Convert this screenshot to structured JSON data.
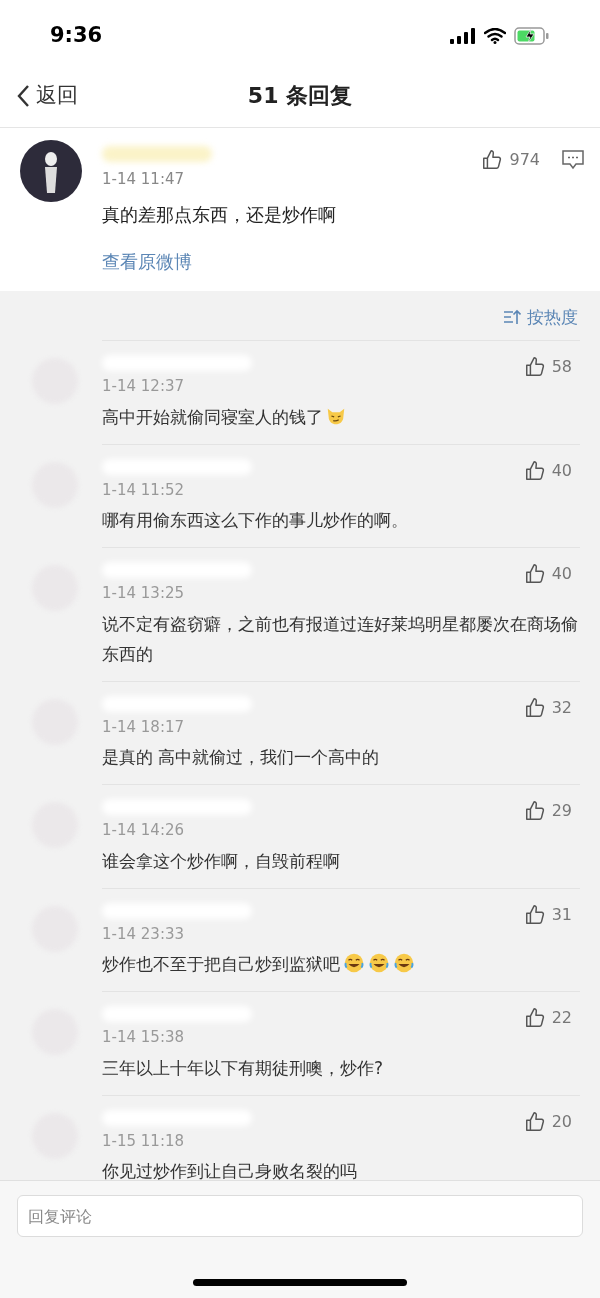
{
  "status_bar": {
    "time": "9:36",
    "charging": true
  },
  "nav": {
    "back": "返回",
    "title": "51 条回复"
  },
  "main_comment": {
    "time": "1-14 11:47",
    "text": "真的差那点东西，还是炒作啊",
    "likes": "974",
    "link": "查看原微博"
  },
  "sort": {
    "label": "按热度"
  },
  "replies": [
    {
      "time": "1-14 12:37",
      "text": "高中开始就偷同寝室人的钱了",
      "likes": "58",
      "emojis": [
        {
          "kind": "smug"
        }
      ]
    },
    {
      "time": "1-14 11:52",
      "text": "哪有用偷东西这么下作的事儿炒作的啊。",
      "likes": "40"
    },
    {
      "time": "1-14 13:25",
      "text": "说不定有盗窃癖，之前也有报道过连好莱坞明星都屡次在商场偷东西的",
      "likes": "40"
    },
    {
      "time": "1-14 18:17",
      "text": "是真的 高中就偷过，我们一个高中的",
      "likes": "32"
    },
    {
      "time": "1-14 14:26",
      "text": "谁会拿这个炒作啊，自毁前程啊",
      "likes": "29"
    },
    {
      "time": "1-14 23:33",
      "text": "炒作也不至于把自己炒到监狱吧",
      "likes": "31",
      "emojis": [
        {
          "kind": "laugh-cry"
        },
        {
          "kind": "laugh-cry"
        },
        {
          "kind": "laugh-cry"
        }
      ]
    },
    {
      "time": "1-14 15:38",
      "text": "三年以上十年以下有期徒刑噢，炒作?",
      "likes": "22"
    },
    {
      "time": "1-15 11:18",
      "text": "你见过炒作到让自己身败名裂的吗",
      "likes": "20"
    }
  ],
  "reply_box": {
    "placeholder": "回复评论"
  }
}
